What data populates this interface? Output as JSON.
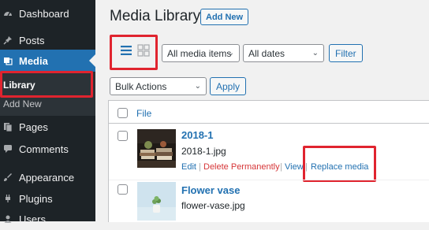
{
  "sidebar": {
    "items": [
      {
        "label": "Dashboard",
        "icon": "dashboard-icon"
      },
      {
        "label": "Posts",
        "icon": "pin-icon"
      },
      {
        "label": "Media",
        "icon": "media-icon"
      },
      {
        "label": "Pages",
        "icon": "pages-icon"
      },
      {
        "label": "Comments",
        "icon": "comments-icon"
      },
      {
        "label": "Appearance",
        "icon": "brush-icon"
      },
      {
        "label": "Plugins",
        "icon": "plugin-icon"
      },
      {
        "label": "Users",
        "icon": "users-icon"
      }
    ],
    "submenu": [
      {
        "label": "Library"
      },
      {
        "label": "Add New"
      }
    ]
  },
  "header": {
    "title": "Media Library",
    "add_new_label": "Add New"
  },
  "toolbar": {
    "filter_type": "All media items",
    "filter_date": "All dates",
    "filter_label": "Filter",
    "bulk_actions": "Bulk Actions",
    "apply_label": "Apply"
  },
  "table": {
    "column_file": "File",
    "rows": [
      {
        "title": "2018-1",
        "filename": "2018-1.jpg",
        "actions": {
          "edit": "Edit",
          "delete": "Delete Permanently",
          "view": "View",
          "replace": "Replace media"
        }
      },
      {
        "title": "Flower vase",
        "filename": "flower-vase.jpg"
      }
    ]
  },
  "colors": {
    "accent": "#2271b1",
    "sidebar_bg": "#1d2327",
    "highlight": "#e0242f",
    "delete": "#d63638"
  }
}
